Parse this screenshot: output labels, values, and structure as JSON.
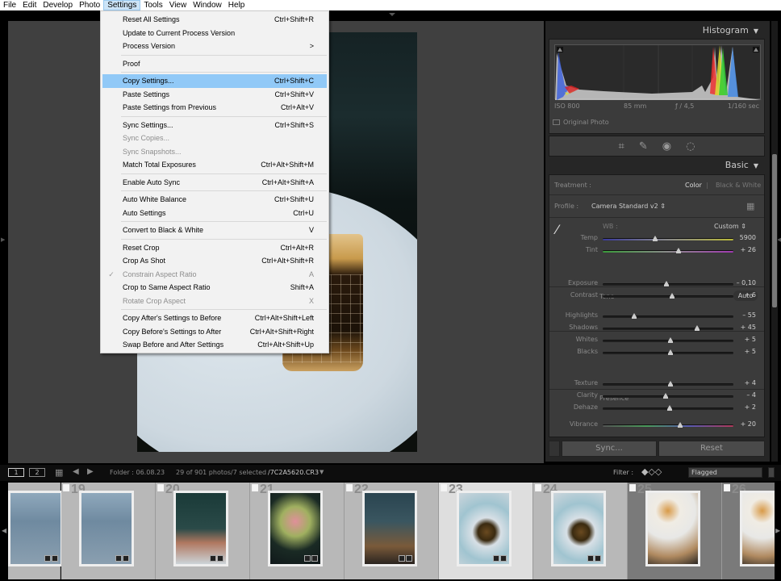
{
  "menubar": {
    "items": [
      "File",
      "Edit",
      "Develop",
      "Photo",
      "Settings",
      "Tools",
      "View",
      "Window",
      "Help"
    ],
    "active": "Settings"
  },
  "settings_menu": {
    "groups": [
      [
        {
          "label": "Reset All Settings",
          "shortcut": "Ctrl+Shift+R",
          "enabled": true
        },
        {
          "label": "Update to Current Process Version",
          "shortcut": "",
          "enabled": true
        },
        {
          "label": "Process Version",
          "shortcut": ">",
          "enabled": true,
          "submenu": true
        }
      ],
      [
        {
          "label": "Proof",
          "shortcut": "",
          "enabled": true
        }
      ],
      [
        {
          "label": "Copy Settings...",
          "shortcut": "Ctrl+Shift+C",
          "enabled": true,
          "highlighted": true
        },
        {
          "label": "Paste Settings",
          "shortcut": "Ctrl+Shift+V",
          "enabled": true
        },
        {
          "label": "Paste Settings from Previous",
          "shortcut": "Ctrl+Alt+V",
          "enabled": true
        }
      ],
      [
        {
          "label": "Sync Settings...",
          "shortcut": "Ctrl+Shift+S",
          "enabled": true
        },
        {
          "label": "Sync Copies...",
          "shortcut": "",
          "enabled": false
        },
        {
          "label": "Sync Snapshots...",
          "shortcut": "",
          "enabled": false
        },
        {
          "label": "Match Total Exposures",
          "shortcut": "Ctrl+Alt+Shift+M",
          "enabled": true
        }
      ],
      [
        {
          "label": "Enable Auto Sync",
          "shortcut": "Ctrl+Alt+Shift+A",
          "enabled": true
        }
      ],
      [
        {
          "label": "Auto White Balance",
          "shortcut": "Ctrl+Shift+U",
          "enabled": true
        },
        {
          "label": "Auto Settings",
          "shortcut": "Ctrl+U",
          "enabled": true
        }
      ],
      [
        {
          "label": "Convert to Black & White",
          "shortcut": "V",
          "enabled": true
        }
      ],
      [
        {
          "label": "Reset Crop",
          "shortcut": "Ctrl+Alt+R",
          "enabled": true
        },
        {
          "label": "Crop As Shot",
          "shortcut": "Ctrl+Alt+Shift+R",
          "enabled": true
        },
        {
          "label": "Constrain Aspect Ratio",
          "shortcut": "A",
          "enabled": false,
          "checked": true
        },
        {
          "label": "Crop to Same Aspect Ratio",
          "shortcut": "Shift+A",
          "enabled": true
        },
        {
          "label": "Rotate Crop Aspect",
          "shortcut": "X",
          "enabled": false
        }
      ],
      [
        {
          "label": "Copy After's Settings to Before",
          "shortcut": "Ctrl+Alt+Shift+Left",
          "enabled": true
        },
        {
          "label": "Copy Before's Settings to After",
          "shortcut": "Ctrl+Alt+Shift+Right",
          "enabled": true
        },
        {
          "label": "Swap Before and After Settings",
          "shortcut": "Ctrl+Alt+Shift+Up",
          "enabled": true
        }
      ]
    ]
  },
  "histogram": {
    "title": "Histogram",
    "iso": "ISO 800",
    "focal": "85 mm",
    "aperture": "ƒ / 4,5",
    "shutter": "1/160 sec",
    "original_photo": "Original Photo"
  },
  "tools": [
    "crop-icon",
    "healing-icon",
    "redeye-icon",
    "masking-icon"
  ],
  "basic": {
    "title": "Basic",
    "treatment_label": "Treatment :",
    "treatment_color": "Color",
    "treatment_bw": "Black & White",
    "profile_label": "Profile :",
    "profile_value": "Camera Standard v2 ⇕",
    "wb_label": "WB :",
    "wb_value": "Custom ⇕",
    "tone_label": "Tone",
    "auto_label": "Auto",
    "presence_label": "Presence",
    "sliders": {
      "temp": {
        "label": "Temp",
        "value": "5900",
        "pos": 0.4
      },
      "tint": {
        "label": "Tint",
        "value": "+ 26",
        "pos": 0.58
      },
      "exposure": {
        "label": "Exposure",
        "value": "– 0,10",
        "pos": 0.49
      },
      "contrast": {
        "label": "Contrast",
        "value": "+ 6",
        "pos": 0.53
      },
      "highlights": {
        "label": "Highlights",
        "value": "– 55",
        "pos": 0.24
      },
      "shadows": {
        "label": "Shadows",
        "value": "+ 45",
        "pos": 0.72
      },
      "whites": {
        "label": "Whites",
        "value": "+ 5",
        "pos": 0.52
      },
      "blacks": {
        "label": "Blacks",
        "value": "+ 5",
        "pos": 0.52
      },
      "texture": {
        "label": "Texture",
        "value": "+ 4",
        "pos": 0.52
      },
      "clarity": {
        "label": "Clarity",
        "value": "– 4",
        "pos": 0.48
      },
      "dehaze": {
        "label": "Dehaze",
        "value": "+ 2",
        "pos": 0.51
      },
      "vibrance": {
        "label": "Vibrance",
        "value": "+ 20",
        "pos": 0.59
      }
    }
  },
  "buttons": {
    "sync": "Sync...",
    "reset": "Reset"
  },
  "filmstrip_bar": {
    "page1": "1",
    "page2": "2",
    "folder": "Folder : 06.08.23",
    "count": "29 of 901 photos",
    "selected": "/7 selected",
    "filename": "/7C2A5620.CR3",
    "filter_label": "Filter :",
    "filter_value": "Flagged"
  },
  "filmstrip": [
    {
      "num": "",
      "sel": false,
      "dark": false,
      "img": "building"
    },
    {
      "num": "19",
      "sel": false,
      "dark": false,
      "img": "building"
    },
    {
      "num": "20",
      "sel": false,
      "dark": false,
      "img": "office"
    },
    {
      "num": "21",
      "sel": false,
      "dark": false,
      "img": "flowers"
    },
    {
      "num": "22",
      "sel": false,
      "dark": false,
      "img": "cafe"
    },
    {
      "num": "23",
      "sel": true,
      "dark": false,
      "img": "coffee"
    },
    {
      "num": "24",
      "sel": false,
      "dark": false,
      "img": "coffee"
    },
    {
      "num": "25",
      "sel": false,
      "dark": true,
      "img": "breakfast"
    },
    {
      "num": "26",
      "sel": false,
      "dark": true,
      "img": "breakfast"
    }
  ]
}
